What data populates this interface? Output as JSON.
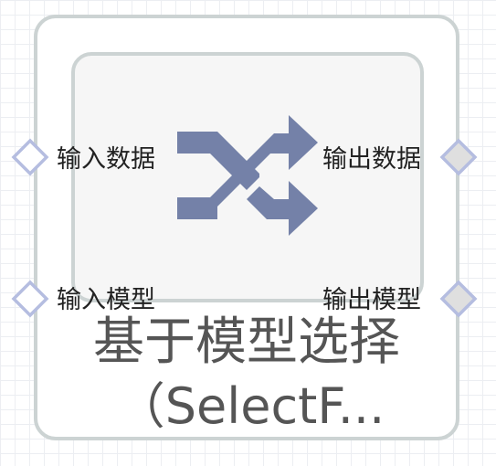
{
  "node": {
    "title_line1": "基于模型选择",
    "title_line2": "（SelectF..."
  },
  "ports": {
    "inputs": [
      {
        "label": "输入数据"
      },
      {
        "label": "输入模型"
      }
    ],
    "outputs": [
      {
        "label": "输出数据"
      },
      {
        "label": "输出模型"
      }
    ]
  },
  "icon": {
    "name": "shuffle-icon",
    "color": "#7481a8"
  },
  "colors": {
    "node_border": "#ccd3d3",
    "inner_fill": "#f6f6f6",
    "port_stroke": "#b5bde0",
    "output_port_fill": "#dfdfdf",
    "title_text": "#555555",
    "label_text": "#222222"
  }
}
